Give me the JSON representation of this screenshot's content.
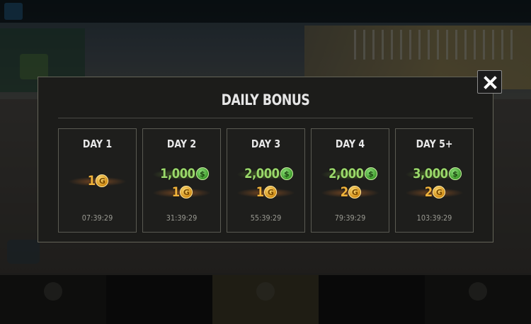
{
  "dialog": {
    "title": "DAILY BONUS",
    "days": [
      {
        "label": "DAY 1",
        "cash": null,
        "gold": "1",
        "timer": "07:39:29"
      },
      {
        "label": "DAY 2",
        "cash": "1,000",
        "gold": "1",
        "timer": "31:39:29"
      },
      {
        "label": "DAY 3",
        "cash": "2,000",
        "gold": "1",
        "timer": "55:39:29"
      },
      {
        "label": "DAY 4",
        "cash": "2,000",
        "gold": "2",
        "timer": "79:39:29"
      },
      {
        "label": "DAY 5+",
        "cash": "3,000",
        "gold": "2",
        "timer": "103:39:29"
      }
    ],
    "close_icon": "close-icon"
  },
  "icons": {
    "cash_coin": "$",
    "gold_coin": "G"
  },
  "colors": {
    "cash": "#9ad86a",
    "gold": "#f0b23a",
    "panel": "#1c1c1a",
    "border": "#5a5a52"
  }
}
